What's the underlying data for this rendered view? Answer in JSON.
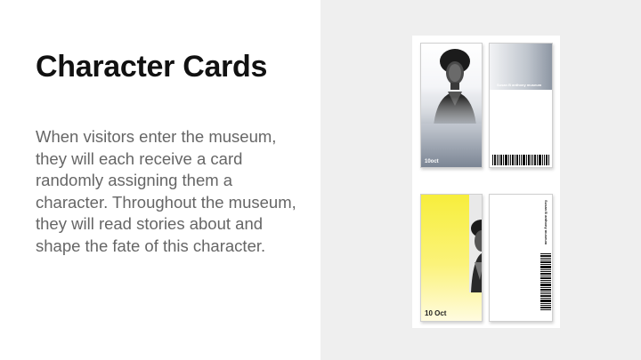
{
  "slide": {
    "title": "Character Cards",
    "body": "When visitors enter the museum, they will each receive a card randomly assigning them a character. Throughout the museum, they will read stories about and shape the fate of this character."
  },
  "cards": {
    "front_grey": {
      "date": "10oct"
    },
    "back_grey": {
      "label": "Susan B anthony museum"
    },
    "front_yellow": {
      "date": "10 Oct"
    },
    "back_white": {
      "label": "Susan B anthony museum"
    }
  },
  "colors": {
    "panel_background": "#efefef",
    "title": "#111111",
    "body_text": "#666666",
    "yellow_card": "#f7ee3c"
  }
}
